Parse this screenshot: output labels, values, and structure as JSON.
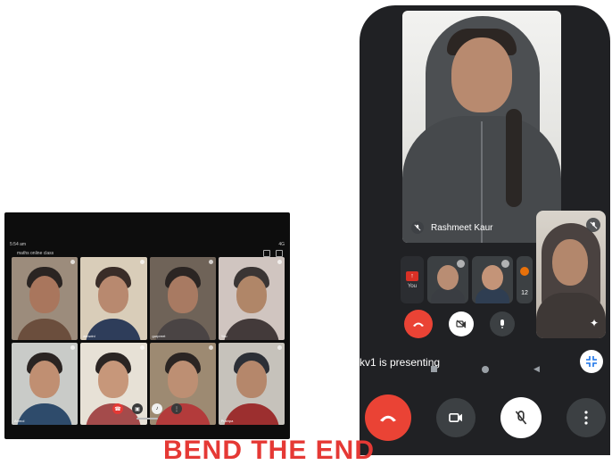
{
  "tablet": {
    "status_time": "5:54 am",
    "status_right": "4G",
    "meeting_name": "maths online class",
    "tiles": [
      {
        "name": "",
        "skin": "#a9765d",
        "hair": "#2a2422",
        "body": "#6b4e3d",
        "bg": "#9c8c7c"
      },
      {
        "name": "ashwini",
        "skin": "#b8896f",
        "hair": "#3a2d28",
        "body": "#2e3d5a",
        "bg": "#d9cdb9"
      },
      {
        "name": "gurpreet",
        "skin": "#a87a62",
        "hair": "#2b2523",
        "body": "#4a4444",
        "bg": "#6f6358"
      },
      {
        "name": "You",
        "skin": "#b08668",
        "hair": "#3a3534",
        "body": "#433a3a",
        "bg": "#d0c5c0"
      },
      {
        "name": "Anmol",
        "skin": "#c08f72",
        "hair": "#2a2422",
        "body": "#2e4b6b",
        "bg": "#c9cbc8"
      },
      {
        "name": "",
        "skin": "#c7977a",
        "hair": "#2b2523",
        "body": "#a44b4b",
        "bg": "#e7e1d6"
      },
      {
        "name": "",
        "skin": "#bd8f73",
        "hair": "#2b2523",
        "body": "#b33b3b",
        "bg": "#9d8a72"
      },
      {
        "name": "Pushpa",
        "skin": "#b5876b",
        "hair": "#2c2f36",
        "body": "#9c2f2f",
        "bg": "#c6c2bb"
      }
    ]
  },
  "phone": {
    "main_participant": "Rashmeet Kaur",
    "present_label": "You",
    "participants_count": "12",
    "presenting_text": "kv1 is presenting"
  },
  "banner": {
    "text": "BEND THE END"
  },
  "colors": {
    "end_call": "#ea4335",
    "control_dark": "#3c4043",
    "phone_bg": "#202124"
  }
}
